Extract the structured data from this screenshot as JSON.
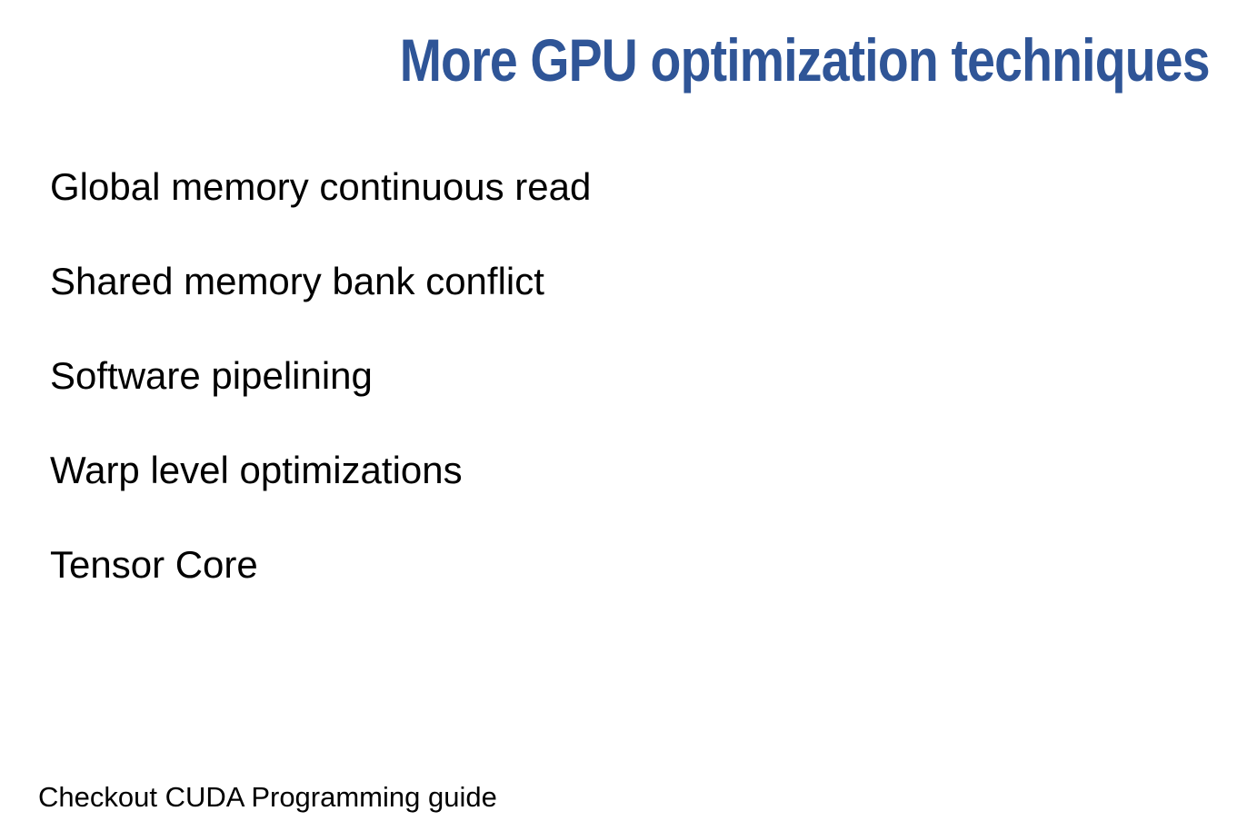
{
  "slide": {
    "title": "More GPU optimization techniques",
    "title_color": "#2f5597",
    "bullets": [
      "Global memory continuous read",
      "Shared memory bank conflict",
      "Software pipelining",
      "Warp level optimizations",
      "Tensor Core"
    ],
    "footnote": "Checkout CUDA Programming guide"
  }
}
